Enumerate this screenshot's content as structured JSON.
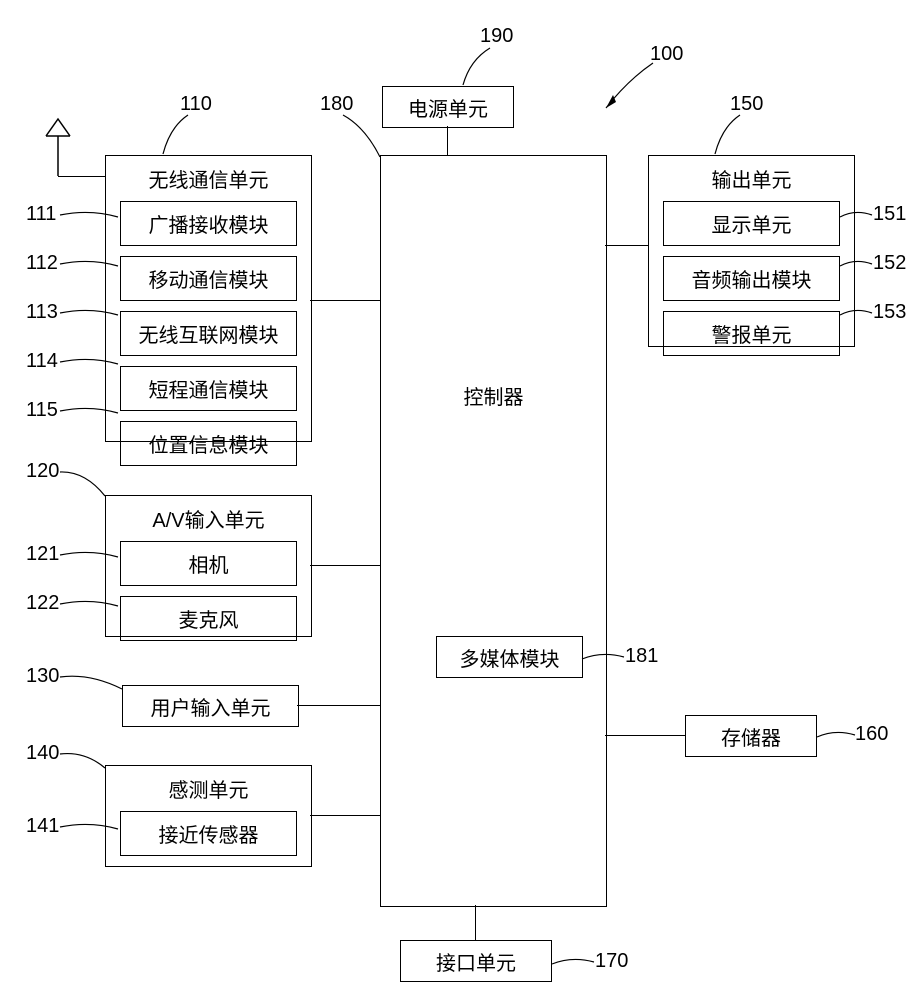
{
  "refs": {
    "r100": "100",
    "r110": "110",
    "r111": "111",
    "r112": "112",
    "r113": "113",
    "r114": "114",
    "r115": "115",
    "r120": "120",
    "r121": "121",
    "r122": "122",
    "r130": "130",
    "r140": "140",
    "r141": "141",
    "r150": "150",
    "r151": "151",
    "r152": "152",
    "r153": "153",
    "r160": "160",
    "r170": "170",
    "r180": "180",
    "r181": "181",
    "r190": "190"
  },
  "labels": {
    "controller": "控制器",
    "power": "电源单元",
    "wireless": "无线通信单元",
    "broadcast": "广播接收模块",
    "mobile": "移动通信模块",
    "internet": "无线互联网模块",
    "shortrange": "短程通信模块",
    "location": "位置信息模块",
    "av": "A/V输入单元",
    "camera": "相机",
    "mic": "麦克风",
    "userinput": "用户输入单元",
    "sensing": "感测单元",
    "proximity": "接近传感器",
    "output": "输出单元",
    "display": "显示单元",
    "audioout": "音频输出模块",
    "alarm": "警报单元",
    "multimedia": "多媒体模块",
    "memory": "存储器",
    "interface": "接口单元"
  }
}
